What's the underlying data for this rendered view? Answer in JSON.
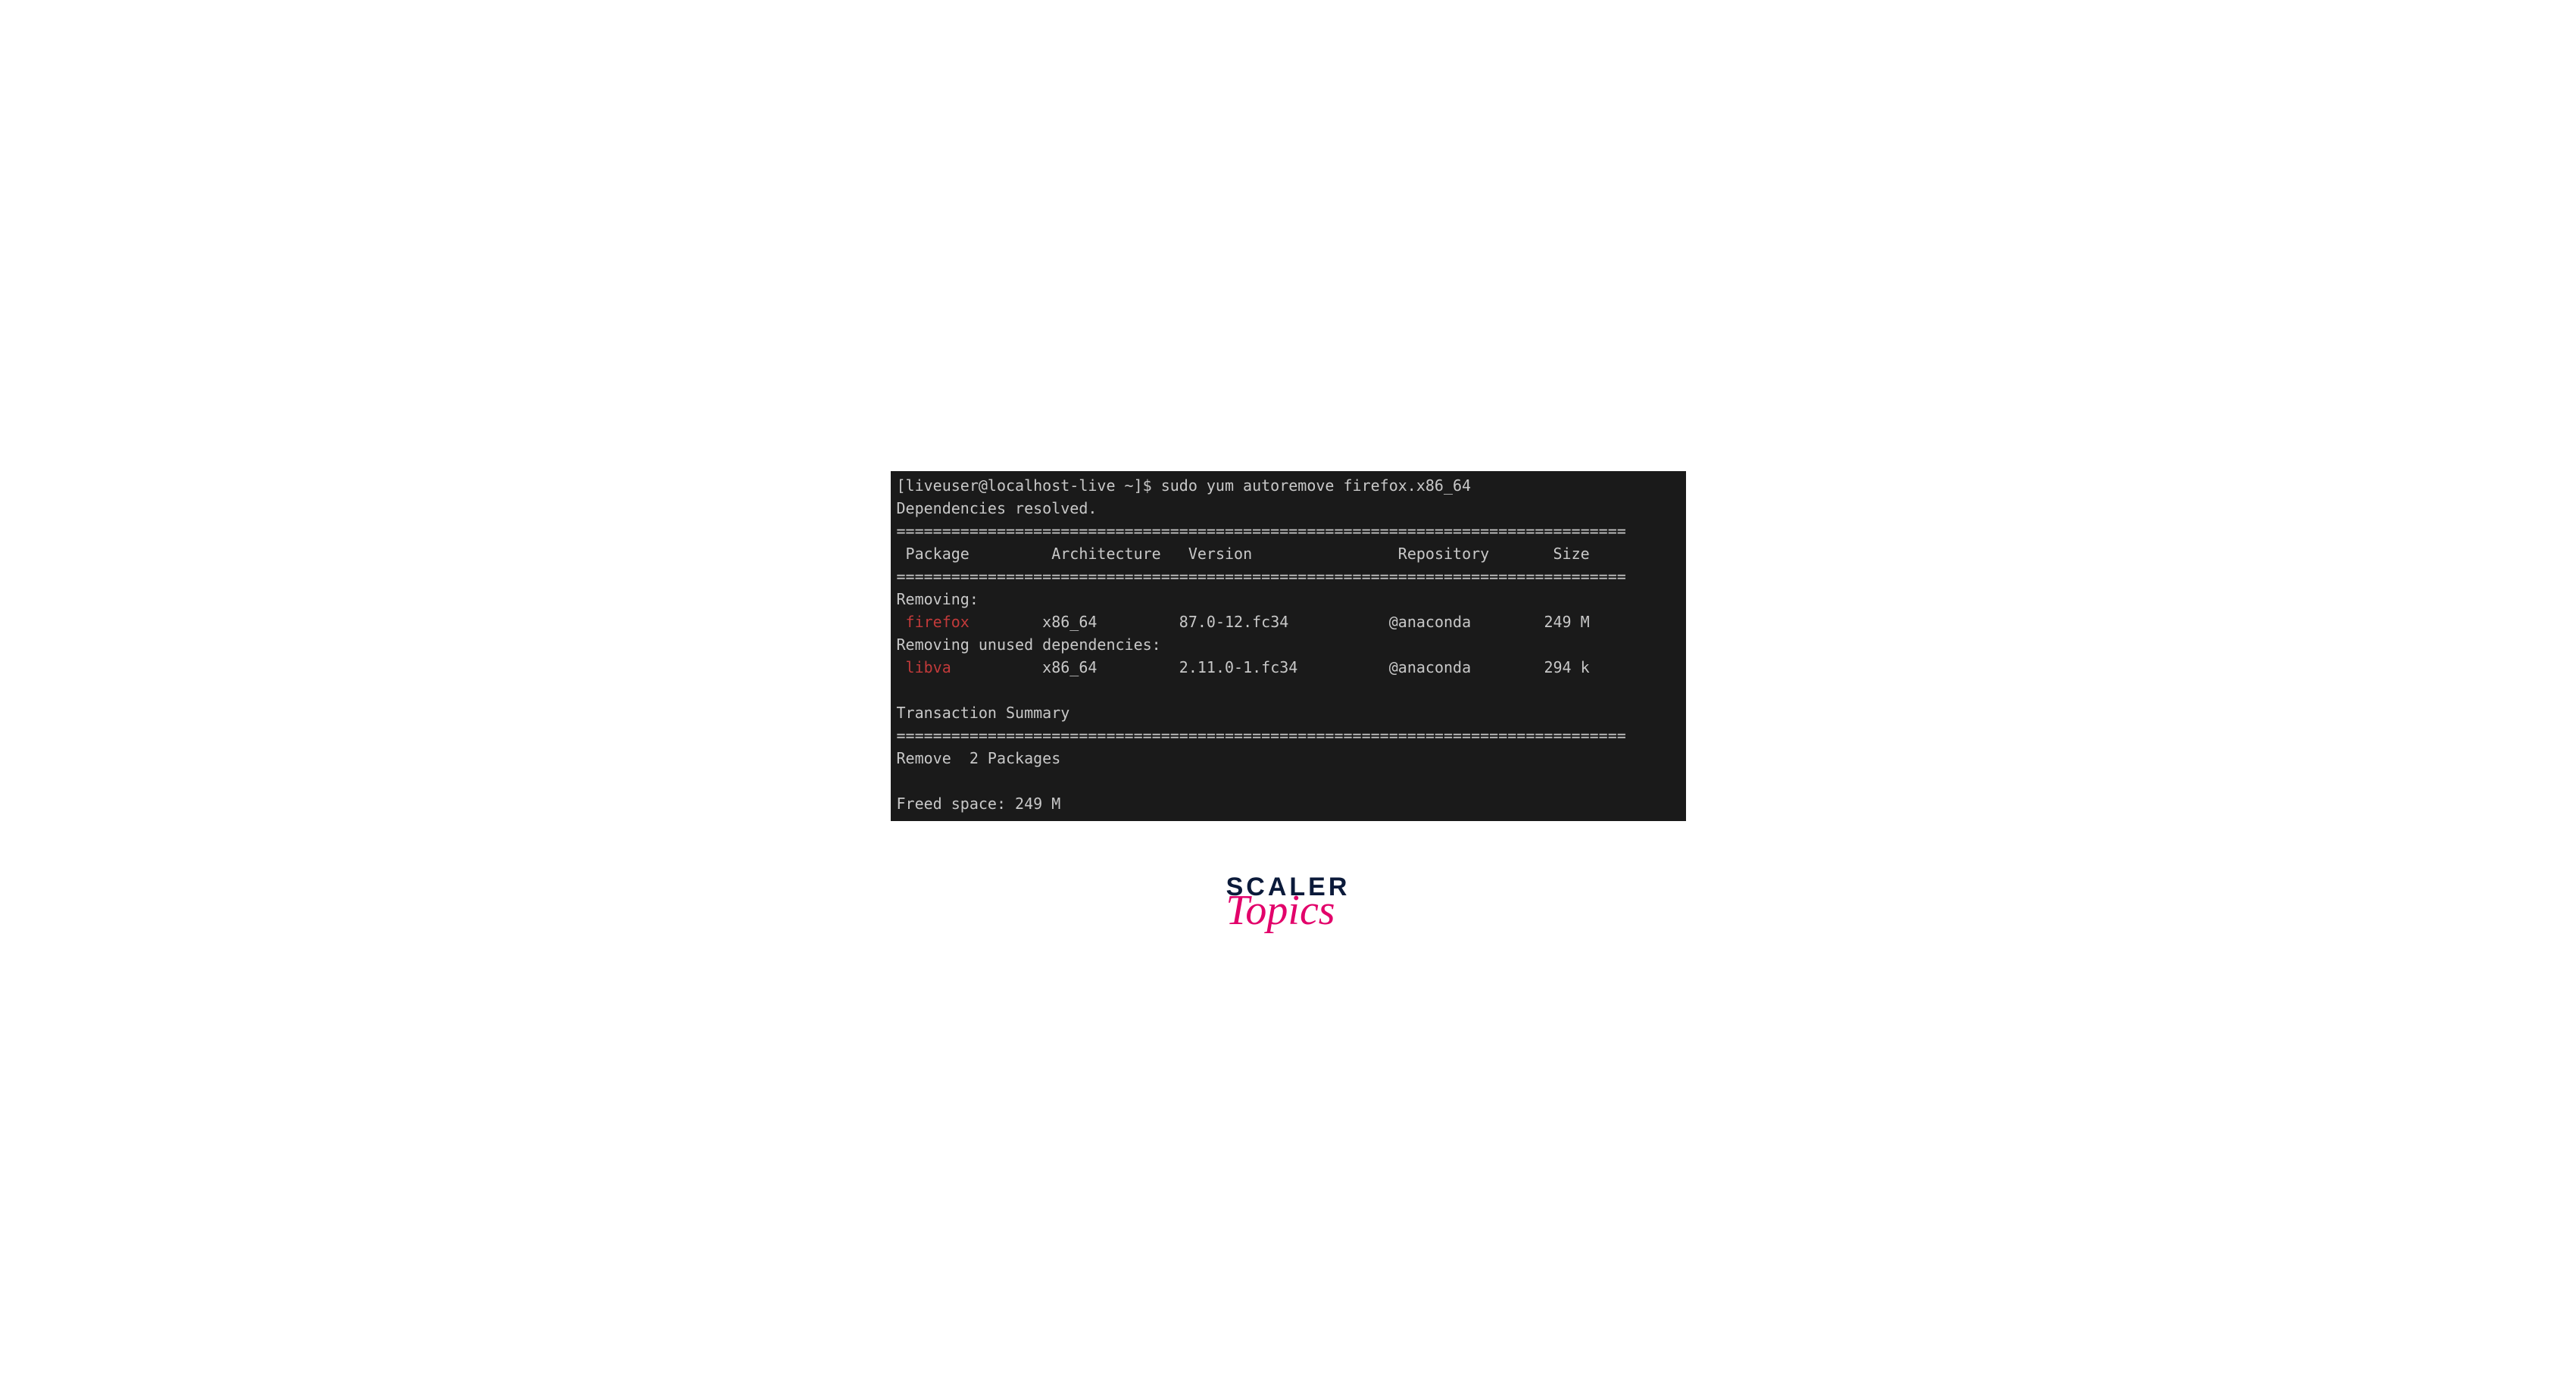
{
  "prompt": "[liveuser@localhost-live ~]$ sudo yum autoremove firefox.x86_64",
  "line_deps": "Dependencies resolved.",
  "divider": "================================================================================",
  "header": {
    "package": " Package",
    "arch": "Architecture",
    "version": "Version",
    "repo": "Repository",
    "size": "Size"
  },
  "removing_label": "Removing:",
  "removing_unused_label": "Removing unused dependencies:",
  "rows": [
    {
      "name": " firefox",
      "arch": "x86_64",
      "version": "87.0-12.fc34",
      "repo": "@anaconda",
      "size": "249 M"
    },
    {
      "name": " libva",
      "arch": "x86_64",
      "version": "2.11.0-1.fc34",
      "repo": "@anaconda",
      "size": "294 k"
    }
  ],
  "transaction_summary": "Transaction Summary",
  "remove_count": "Remove  2 Packages",
  "freed_space": "Freed space: 249 M",
  "logo": {
    "scaler": "SCALER",
    "topics": "Topics"
  }
}
